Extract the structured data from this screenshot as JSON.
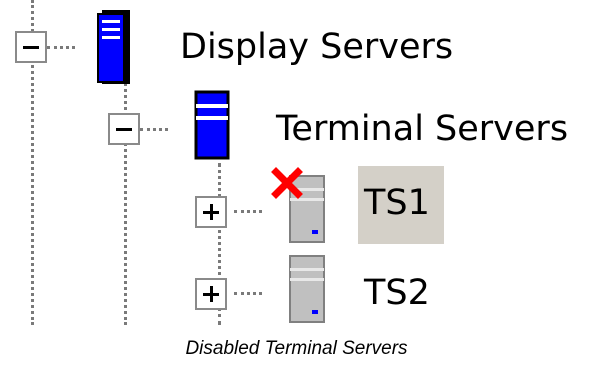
{
  "tree": {
    "root": {
      "label": "Display Servers",
      "expander": "minus",
      "icon": "server-tower-blue-icon",
      "child": {
        "label": "Terminal Servers",
        "expander": "minus",
        "icon": "server-stack-blue-icon",
        "children": [
          {
            "label": "TS1",
            "expander": "plus",
            "icon": "server-gray-icon",
            "status": "disabled",
            "status_icon": "red-x-icon",
            "selected": true
          },
          {
            "label": "TS2",
            "expander": "plus",
            "icon": "server-gray-icon",
            "status": "enabled",
            "selected": false
          }
        ]
      }
    }
  },
  "caption": "Disabled Terminal Servers",
  "colors": {
    "blue_server": "#0000ff",
    "gray_server": "#b8b8b8",
    "selection_bg": "#d4d0c8",
    "disabled_x": "#ff0000",
    "tree_lines": "#7a7a7a"
  }
}
